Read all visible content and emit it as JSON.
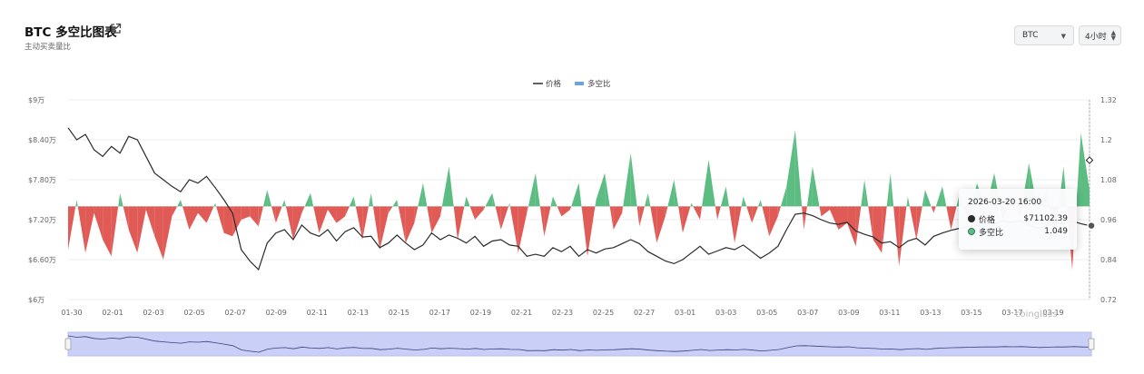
{
  "header": {
    "title": "BTC 多空比图表",
    "subtitle": "主动买卖量比"
  },
  "controls": {
    "coin_value": "BTC",
    "interval_value": "4小时"
  },
  "tooltip": {
    "time": "2026-03-20 16:00",
    "price_label": "价格",
    "price_value": "$71102.39",
    "ratio_label": "多空比",
    "ratio_value": "1.049"
  },
  "watermark": "coinglass",
  "colors": {
    "price_line": "#2b2b2b",
    "ratio_up": "#5cbd82",
    "ratio_down": "#e05a56",
    "legend_ratio": "#6ba3e0",
    "navigator_fill": "#c9cff7"
  },
  "chart_data": {
    "type": "line",
    "legend": [
      "价格",
      "多空比"
    ],
    "legend_position": "top-center",
    "left_axis": {
      "ticks": [
        "$6万",
        "$6.60万",
        "$7.20万",
        "$7.80万",
        "$8.40万",
        "$9万"
      ],
      "range": [
        60000,
        90000
      ]
    },
    "right_axis": {
      "ticks": [
        "0.72",
        "0.84",
        "0.96",
        "1.08",
        "1.2",
        "1.32"
      ],
      "range": [
        0.72,
        1.32
      ],
      "baseline": 1.0
    },
    "x_ticks": [
      "01-30",
      "02-01",
      "02-03",
      "02-05",
      "02-07",
      "02-09",
      "02-11",
      "02-13",
      "02-15",
      "02-17",
      "02-19",
      "02-21",
      "02-23",
      "02-25",
      "02-27",
      "03-01",
      "03-03",
      "03-05",
      "03-07",
      "03-09",
      "03-11",
      "03-13",
      "03-15",
      "03-17",
      "03-19"
    ],
    "grid": true,
    "series": [
      {
        "name": "价格",
        "axis": "left",
        "values": [
          85800,
          84000,
          84800,
          82500,
          81500,
          83000,
          82000,
          84500,
          84000,
          81500,
          79000,
          78000,
          77000,
          76200,
          78000,
          77500,
          78500,
          76800,
          75000,
          73000,
          67500,
          65800,
          64500,
          68500,
          70000,
          70500,
          69000,
          71200,
          70000,
          69500,
          70500,
          68800,
          70200,
          70800,
          69400,
          69500,
          67800,
          68500,
          69700,
          68500,
          67500,
          68200,
          70000,
          69000,
          69700,
          69200,
          68500,
          69500,
          68000,
          68800,
          69000,
          68200,
          68000,
          66500,
          66800,
          66500,
          67800,
          67200,
          68000,
          66500,
          67500,
          67000,
          67600,
          67800,
          68400,
          69000,
          68400,
          67200,
          66500,
          65800,
          65400,
          66000,
          67000,
          68000,
          66800,
          67300,
          67800,
          67500,
          68200,
          67200,
          66200,
          67000,
          68000,
          70500,
          72800,
          73000,
          72600,
          72000,
          71500,
          71300,
          71600,
          70300,
          69800,
          69400,
          68500,
          68700,
          67800,
          68800,
          69200,
          68200,
          69500,
          70000,
          70400,
          70700,
          71000,
          71200,
          71500,
          71400,
          71800,
          71600,
          71800,
          71200,
          70700,
          71000,
          71500,
          71400,
          71800,
          71400,
          71100
        ]
      },
      {
        "name": "多空比",
        "axis": "right",
        "values": [
          0.87,
          1.02,
          0.86,
          0.98,
          0.9,
          0.85,
          1.04,
          0.93,
          0.86,
          0.99,
          0.91,
          0.84,
          0.97,
          1.02,
          0.93,
          0.98,
          0.95,
          1.01,
          0.92,
          0.91,
          0.96,
          0.97,
          0.94,
          1.05,
          0.95,
          1.02,
          0.9,
          0.98,
          1.04,
          0.92,
          0.99,
          0.95,
          0.97,
          1.03,
          0.9,
          1.04,
          0.87,
          0.98,
          1.02,
          0.89,
          0.95,
          1.07,
          0.92,
          0.97,
          1.12,
          0.9,
          1.03,
          0.96,
          0.99,
          1.04,
          0.93,
          1.01,
          0.86,
          0.98,
          1.1,
          0.91,
          1.03,
          0.97,
          0.99,
          1.07,
          0.85,
          1.02,
          1.1,
          0.93,
          0.98,
          1.16,
          0.94,
          1.04,
          0.89,
          0.97,
          1.08,
          0.92,
          1.01,
          0.96,
          1.14,
          0.96,
          1.06,
          0.89,
          1.03,
          0.95,
          1.02,
          0.91,
          0.97,
          1.06,
          1.23,
          0.93,
          1.12,
          0.97,
          0.99,
          0.93,
          0.95,
          0.88,
          1.08,
          0.9,
          0.86,
          1.1,
          0.82,
          1.03,
          0.9,
          1.05,
          0.98,
          1.06,
          0.93,
          1.04,
          0.95,
          1.07,
          0.99,
          1.1,
          0.96,
          1.03,
          0.97,
          1.13,
          0.99,
          1.05,
          0.9,
          1.12,
          0.81,
          1.22,
          1.049
        ]
      }
    ]
  }
}
